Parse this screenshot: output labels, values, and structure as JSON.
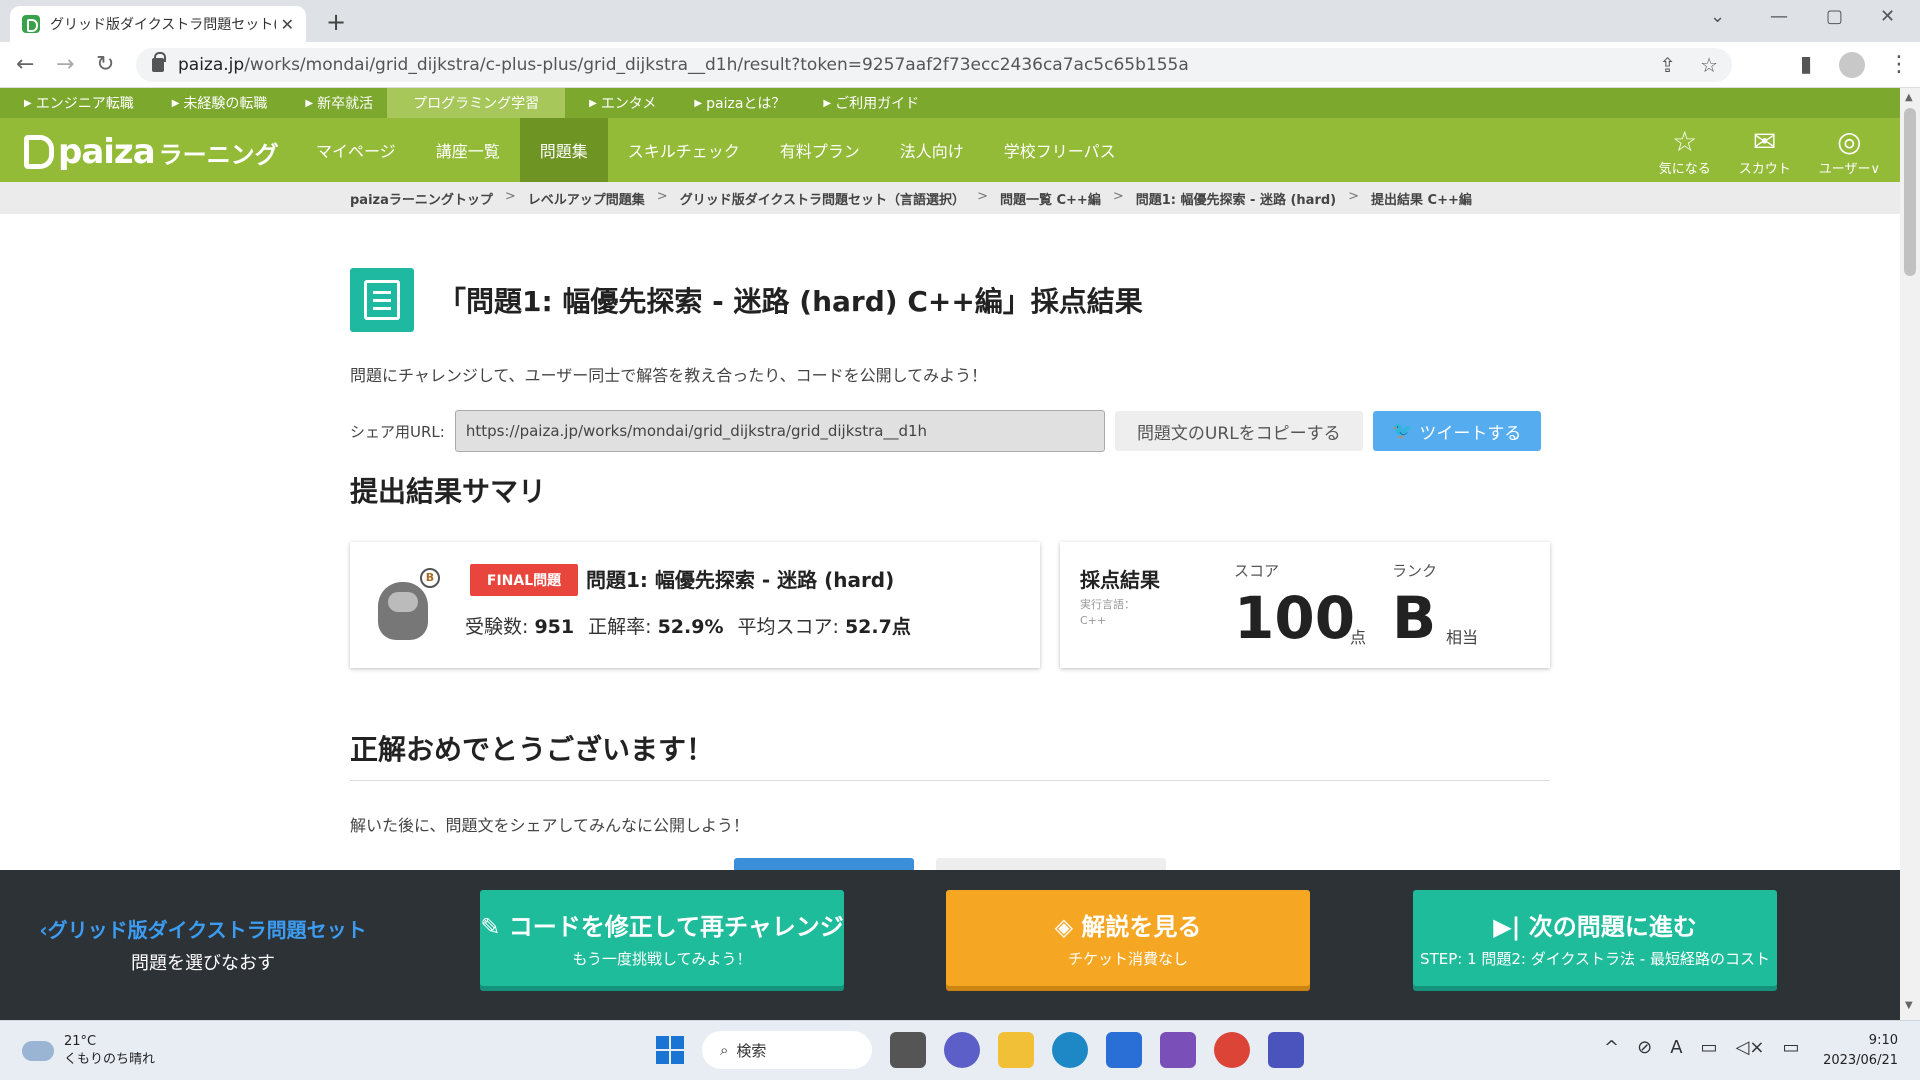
{
  "browser": {
    "tab_title": "グリッド版ダイクストラ問題セット(C++",
    "url_host": "paiza.jp",
    "url_path": "/works/mondai/grid_dijkstra/c-plus-plus/grid_dijkstra__d1h/result?token=9257aaf2f73ecc2436ca7ac5c65b155a"
  },
  "topbar": {
    "items": [
      "エンジニア転職",
      "未経験の転職",
      "新卒就活",
      "プログラミング学習",
      "エンタメ",
      "paizaとは？",
      "ご利用ガイド"
    ],
    "active_index": 3
  },
  "header": {
    "logo_main": "paiza",
    "logo_sub": "ラーニング",
    "nav": [
      "マイページ",
      "講座一覧",
      "問題集",
      "スキルチェック",
      "有料プラン",
      "法人向け",
      "学校フリーパス"
    ],
    "nav_active_index": 2,
    "icons": [
      {
        "label": "気になる",
        "icon": "star-icon"
      },
      {
        "label": "スカウト",
        "icon": "mail-icon"
      },
      {
        "label": "ユーザー∨",
        "icon": "user-icon"
      }
    ]
  },
  "breadcrumb": [
    "paizaラーニングトップ",
    "レベルアップ問題集",
    "グリッド版ダイクストラ問題セット（言語選択）",
    "問題一覧 C++編",
    "問題1: 幅優先探索 - 迷路 (hard)",
    "提出結果 C++編"
  ],
  "page": {
    "title": "「問題1: 幅優先探索 - 迷路 (hard) C++編」採点結果",
    "lead": "問題にチャレンジして、ユーザー同士で解答を教え合ったり、コードを公開してみよう！",
    "share_label": "シェア用URL:",
    "share_url": "https://paiza.jp/works/mondai/grid_dijkstra/grid_dijkstra__d1h",
    "copy_button": "問題文のURLをコピーする",
    "tweet_button": "ツイートする",
    "summary_heading": "提出結果サマリ",
    "final_tag": "FINAL問題",
    "problem_name": "問題1: 幅優先探索 - 迷路 (hard)",
    "stats": {
      "examinees_label": "受験数:",
      "examinees": "951",
      "accuracy_label": "正解率:",
      "accuracy": "52.9%",
      "avg_label": "平均スコア:",
      "avg": "52.7点"
    },
    "result": {
      "title": "採点結果",
      "lang_label": "実行言語：",
      "lang": "C++",
      "score_label": "スコア",
      "score": "100",
      "score_unit": "点",
      "rank_label": "ランク",
      "rank": "B",
      "rank_unit": "相当"
    },
    "congrats_heading": "正解おめでとうございます！",
    "after_text": "解いた後に、問題文をシェアしてみんなに公開しよう！"
  },
  "actionbar": {
    "back_line1": "グリッド版ダイクストラ問題セット",
    "back_line2": "問題を選びなおす",
    "retry_title": "コードを修正して再チャレンジ",
    "retry_sub": "もう一度挑戦してみよう！",
    "explain_title": "解説を見る",
    "explain_sub": "チケット消費なし",
    "next_title": "次の問題に進む",
    "next_sub": "STEP: 1 問題2: ダイクストラ法 - 最短経路のコスト"
  },
  "taskbar": {
    "temp": "21°C",
    "weather": "くもりのち晴れ",
    "search": "検索",
    "time": "9:10",
    "date": "2023/06/21"
  }
}
